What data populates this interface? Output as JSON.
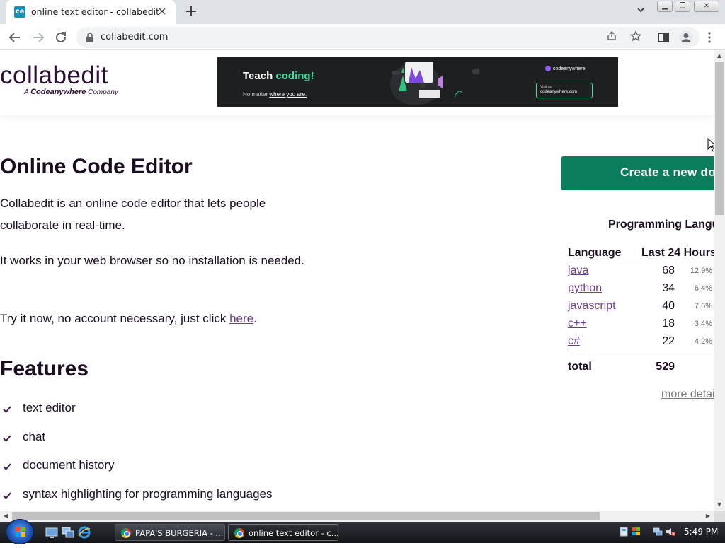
{
  "browser": {
    "tab_title": "online text editor - collabedit",
    "favicon_text": "ce",
    "url": "collabedit.com"
  },
  "header": {
    "logo": "collabedit",
    "logo_sub_prefix": "A",
    "logo_sub_brand": "Codeanywhere",
    "logo_sub_suffix": "Company"
  },
  "ad": {
    "title_main": "Teach ",
    "title_accent": "coding!",
    "subtitle_prefix": "No matter ",
    "subtitle_link": "where you are.",
    "brand": "codeanywhere",
    "visit_label": "Visit us",
    "visit_url": "codeanywhere.com",
    "accent_color": "#3ee0a0"
  },
  "main": {
    "title": "Online Code Editor",
    "para1": "Collabedit is an online code editor that lets people collaborate in real-time.",
    "para2": "It works in your web browser so no installation is needed.",
    "para3_prefix": "Try it now, no account necessary, just click ",
    "para3_link": "here",
    "para3_suffix": ".",
    "features_title": "Features",
    "features": [
      "text editor",
      "chat",
      "document history",
      "syntax highlighting for programming languages"
    ]
  },
  "sidebar": {
    "create_button": "Create a new document",
    "stats_title": "Programming Languages",
    "col_language": "Language",
    "col_last24": "Last 24 Hours",
    "rows": [
      {
        "lang": "java",
        "count": "68",
        "pct": "12.9%"
      },
      {
        "lang": "python",
        "count": "34",
        "pct": "6.4%"
      },
      {
        "lang": "javascript",
        "count": "40",
        "pct": "7.6%"
      },
      {
        "lang": "c++",
        "count": "18",
        "pct": "3.4%"
      },
      {
        "lang": "c#",
        "count": "22",
        "pct": "4.2%"
      }
    ],
    "total_label": "total",
    "total_count": "529",
    "more_link": "more details"
  },
  "taskbar": {
    "tasks": [
      "PAPA'S BURGERIA - ...",
      "online text editor - c..."
    ],
    "clock": "5:49 PM"
  },
  "colors": {
    "brand_purple": "#2a0f33",
    "link_purple": "#6b3f87",
    "button_green": "#0b7d5c"
  }
}
